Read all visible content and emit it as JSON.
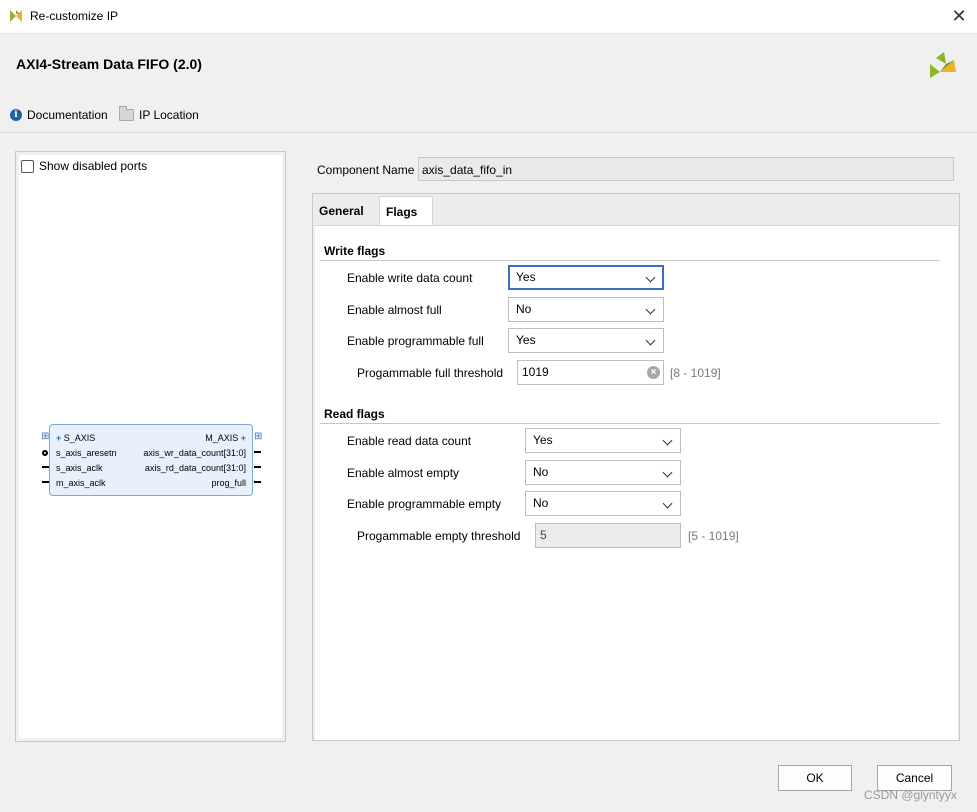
{
  "window": {
    "title": "Re-customize IP",
    "close_glyph": "✕"
  },
  "header": {
    "ip_name": "AXI4-Stream Data FIFO (2.0)",
    "documentation": "Documentation",
    "ip_location": "IP Location"
  },
  "left_panel": {
    "show_disabled_ports": "Show disabled ports",
    "block": {
      "left_pins": [
        "S_AXIS",
        "s_axis_aresetn",
        "s_axis_aclk",
        "m_axis_aclk"
      ],
      "right_pins": [
        "M_AXIS",
        "axis_wr_data_count[31:0]",
        "axis_rd_data_count[31:0]",
        "prog_full"
      ]
    }
  },
  "component": {
    "label": "Component Name",
    "value": "axis_data_fifo_in"
  },
  "tabs": {
    "general": "General",
    "flags": "Flags"
  },
  "write_flags": {
    "title": "Write flags",
    "write_data_count": {
      "label": "Enable write data count",
      "value": "Yes"
    },
    "almost_full": {
      "label": "Enable almost full",
      "value": "No"
    },
    "prog_full": {
      "label": "Enable programmable full",
      "value": "Yes"
    },
    "prog_full_thresh": {
      "label": "Progammable full threshold",
      "value": "1019",
      "range": "[8 - 1019]"
    }
  },
  "read_flags": {
    "title": "Read flags",
    "read_data_count": {
      "label": "Enable read data count",
      "value": "Yes"
    },
    "almost_empty": {
      "label": "Enable almost empty",
      "value": "No"
    },
    "prog_empty": {
      "label": "Enable programmable empty",
      "value": "No"
    },
    "prog_empty_thresh": {
      "label": "Progammable empty threshold",
      "value": "5",
      "range": "[5 - 1019]"
    }
  },
  "buttons": {
    "ok": "OK",
    "cancel": "Cancel"
  },
  "watermark": "CSDN @glyntyyx",
  "colors": {
    "accent": "#3d6fbf",
    "logo": "#8bb62b"
  }
}
